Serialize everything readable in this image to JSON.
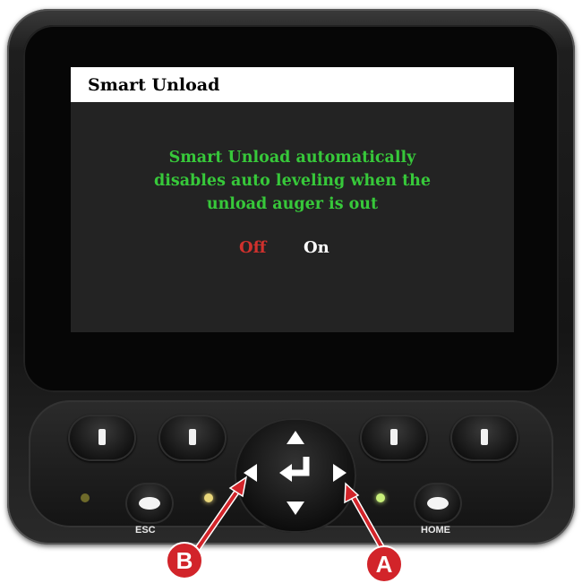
{
  "screen": {
    "title": "Smart Unload",
    "message_lines": [
      "Smart Unload automatically",
      "disables auto leveling when the",
      "unload auger is out"
    ],
    "options": {
      "off": "Off",
      "on": "On"
    },
    "selected_option": "Off"
  },
  "keypad": {
    "esc_label": "ESC",
    "home_label": "HOME",
    "led_colors": {
      "left": "#6e6a2a",
      "middle": "#e9d77a",
      "right": "#c8f07a"
    }
  },
  "callouts": {
    "a": "A",
    "b": "B"
  },
  "colors": {
    "message": "#37c83a",
    "selected": "#d0312d",
    "unselected": "#ffffff",
    "callout": "#d2242a"
  }
}
